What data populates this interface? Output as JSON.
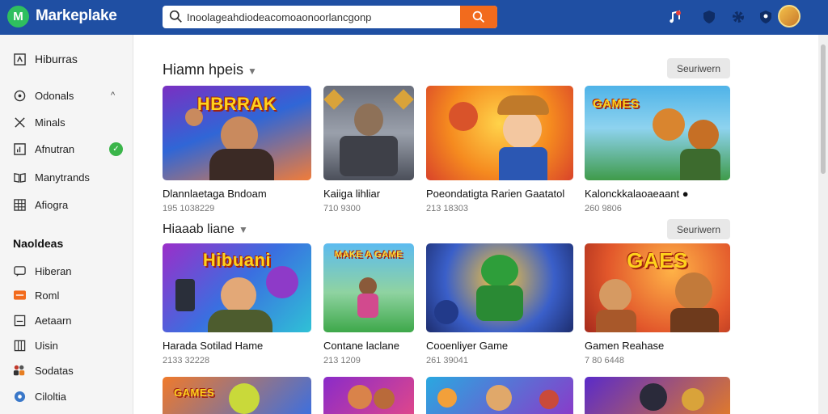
{
  "app": {
    "brand": "Markeplake",
    "logo_glyph": "M"
  },
  "search": {
    "value": "Inoolageahdiodeacomoaonoorlancgonp"
  },
  "header_icons": [
    "music-notification-icon",
    "shield-icon",
    "settings-gear-icon",
    "security-badge-icon",
    "user-avatar"
  ],
  "sidebar": {
    "top_item": {
      "label": "Hiburras",
      "icon": "home-icon"
    },
    "items": [
      {
        "label": "Odonals",
        "icon": "category-icon",
        "chevron": "^"
      },
      {
        "label": "Minals",
        "icon": "tools-icon"
      },
      {
        "label": "Afnutran",
        "icon": "chart-icon",
        "badge": "✓"
      },
      {
        "label": "Manytrands",
        "icon": "book-icon"
      },
      {
        "label": "Afiogra",
        "icon": "grid-icon"
      }
    ],
    "section_heading": "Naoldeas",
    "section_items": [
      {
        "label": "Hiberan",
        "icon": "chat-icon"
      },
      {
        "label": "Roml",
        "icon": "tag-icon"
      },
      {
        "label": "Aetaarn",
        "icon": "document-icon"
      },
      {
        "label": "Uisin",
        "icon": "columns-icon"
      },
      {
        "label": "Sodatas",
        "icon": "people-icon"
      },
      {
        "label": "Ciloltia",
        "icon": "globe-icon"
      }
    ]
  },
  "sections": [
    {
      "title": "Hiamn hpeis",
      "see_all": "Seuriwern",
      "cards": [
        {
          "thumb_text": "HBRRAK",
          "title": "Dlannlaetaga Bndoam",
          "meta": "195 1038229"
        },
        {
          "thumb_text": "",
          "title": "Kaiiga lihliar",
          "meta": "710 9300"
        },
        {
          "thumb_text": "",
          "title": "Poeondatigta Rarien Gaatatol",
          "meta": "213 18303"
        },
        {
          "thumb_text": "GAMES",
          "title": "Kalonckkalaoaeaant ●",
          "meta": "260 9806"
        }
      ]
    },
    {
      "title": "Hiaaab liane",
      "see_all": "Seuriwern",
      "cards": [
        {
          "thumb_text": "Hibuani",
          "title": "Harada Sotilad Hame",
          "meta": "2133 32228"
        },
        {
          "thumb_text": "MAKE A GAME",
          "title": "Contane laclane",
          "meta": "213 1209"
        },
        {
          "thumb_text": "",
          "title": "Cooenliyer Game",
          "meta": "261 39041"
        },
        {
          "thumb_text": "GAES",
          "title": "Gamen Reahase",
          "meta": "7 80 6448"
        }
      ]
    },
    {
      "title": "",
      "cards": [
        {
          "thumb_text": "GAMES",
          "title": "",
          "meta": ""
        },
        {
          "thumb_text": "",
          "title": "",
          "meta": ""
        },
        {
          "thumb_text": "",
          "title": "",
          "meta": ""
        },
        {
          "thumb_text": "",
          "title": "",
          "meta": ""
        }
      ]
    }
  ],
  "colors": {
    "topbar": "#1f4fa3",
    "accent": "#f26b1d",
    "logo": "#2fbf5f",
    "badge": "#3bb54a"
  }
}
